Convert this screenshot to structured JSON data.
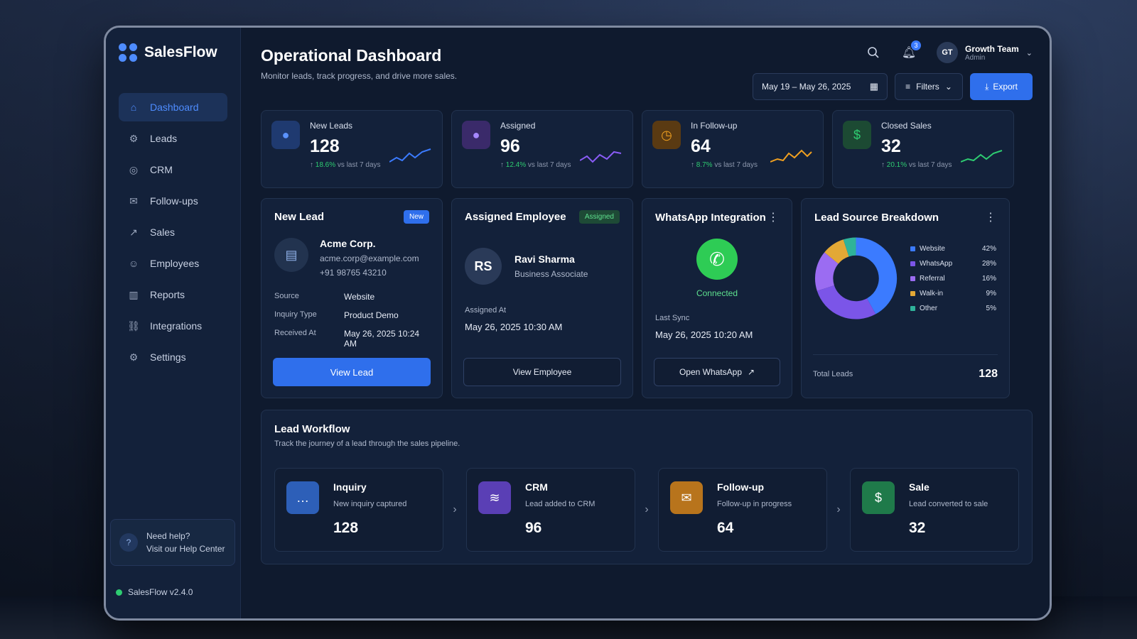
{
  "app": {
    "name": "SalesFlow",
    "version": "SalesFlow v2.4.0"
  },
  "sidebar": {
    "items": [
      {
        "label": "Dashboard",
        "icon": "home-icon"
      },
      {
        "label": "Leads",
        "icon": "leads-icon"
      },
      {
        "label": "CRM",
        "icon": "crm-icon"
      },
      {
        "label": "Follow-ups",
        "icon": "follow-up-icon"
      },
      {
        "label": "Sales",
        "icon": "sales-icon"
      },
      {
        "label": "Employees",
        "icon": "user-icon"
      },
      {
        "label": "Reports",
        "icon": "bar-chart-icon"
      },
      {
        "label": "Integrations",
        "icon": "integrations-icon"
      },
      {
        "label": "Settings",
        "icon": "gear-icon"
      }
    ],
    "help": {
      "line1": "Need help?",
      "line2": "Visit our Help Center"
    }
  },
  "header": {
    "title": "Operational Dashboard",
    "subtitle": "Monitor leads, track progress, and drive more sales.",
    "notifications": "3",
    "user": {
      "initials": "GT",
      "name": "Growth Team",
      "role": "Admin"
    },
    "date_range": "May 19 – May 26, 2025",
    "filters_label": "Filters",
    "export_label": "Export"
  },
  "stats": [
    {
      "label": "New Leads",
      "value": "128",
      "delta": "18.6%",
      "delta_suffix": "vs last 7 days",
      "color": "#3b7bff"
    },
    {
      "label": "Assigned",
      "value": "96",
      "delta": "12.4%",
      "delta_suffix": "vs last 7 days",
      "color": "#8a5cf6"
    },
    {
      "label": "In Follow-up",
      "value": "64",
      "delta": "8.7%",
      "delta_suffix": "vs last 7 days",
      "color": "#f0a020"
    },
    {
      "label": "Closed Sales",
      "value": "32",
      "delta": "20.1%",
      "delta_suffix": "vs last 7 days",
      "color": "#2ecc71"
    }
  ],
  "new_lead": {
    "title": "New Lead",
    "tag": "New",
    "company": "Acme Corp.",
    "email": "acme.corp@example.com",
    "phone": "+91 98765 43210",
    "fields": [
      {
        "k": "Source",
        "v": "Website"
      },
      {
        "k": "Inquiry Type",
        "v": "Product Demo"
      },
      {
        "k": "Received At",
        "v": "May 26, 2025 10:24 AM"
      }
    ],
    "button": "View Lead"
  },
  "assigned": {
    "title": "Assigned Employee",
    "tag": "Assigned",
    "initials": "RS",
    "name": "Ravi Sharma",
    "role": "Business Associate",
    "at_label": "Assigned At",
    "at_value": "May 26, 2025 10:30 AM",
    "button": "View Employee"
  },
  "whatsapp": {
    "title": "WhatsApp Integration",
    "status": "Connected",
    "sync_label": "Last Sync",
    "sync_value": "May 26, 2025 10:20 AM",
    "button": "Open WhatsApp"
  },
  "lead_source": {
    "title": "Lead Source Breakdown",
    "total_label": "Total Leads",
    "total_value": "128"
  },
  "chart_data": {
    "type": "pie",
    "title": "Lead Source Breakdown",
    "categories": [
      "Website",
      "WhatsApp",
      "Referral",
      "Walk-in",
      "Other"
    ],
    "values": [
      42,
      28,
      16,
      9,
      5
    ],
    "labels": [
      "42%",
      "28%",
      "16%",
      "9%",
      "5%"
    ],
    "colors": [
      "#3b7bff",
      "#7b55e8",
      "#9b6cf2",
      "#e3a835",
      "#2fb39a"
    ],
    "legend": "right"
  },
  "workflow": {
    "title": "Lead Workflow",
    "subtitle": "Track the journey of a lead through the sales pipeline.",
    "steps": [
      {
        "name": "Inquiry",
        "desc": "New inquiry captured",
        "value": "128",
        "color": "#2d5fb8"
      },
      {
        "name": "CRM",
        "desc": "Lead added to CRM",
        "value": "96",
        "color": "#5a3fb5"
      },
      {
        "name": "Follow-up",
        "desc": "Follow-up in progress",
        "value": "64",
        "color": "#b8741c"
      },
      {
        "name": "Sale",
        "desc": "Lead converted to sale",
        "value": "32",
        "color": "#1f7a4a"
      }
    ]
  }
}
